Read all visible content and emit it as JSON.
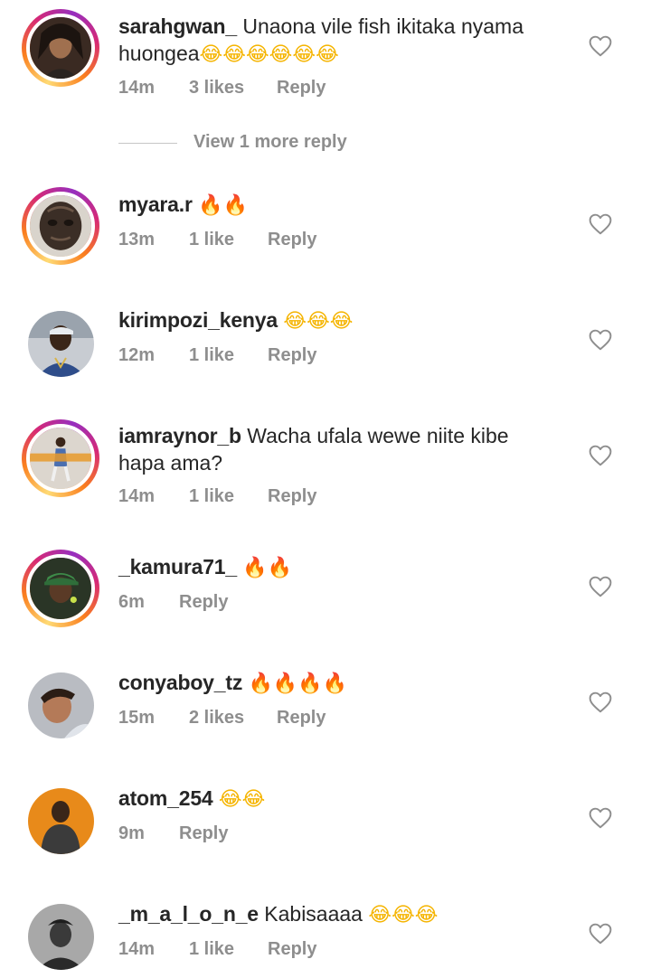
{
  "comments": [
    {
      "username": "sarahgwan_",
      "text": "Unaona vile fish ikitaka nyama huongea",
      "text_line2": "",
      "emoji": "😂😂😂😂😂😂",
      "time": "14m",
      "likes": "3 likes",
      "reply": "Reply",
      "story_ring": true,
      "avatar_color": "#3a2a22"
    },
    {
      "username": "myara.r",
      "text": "",
      "emoji": "🔥🔥",
      "time": "13m",
      "likes": "1 like",
      "reply": "Reply",
      "story_ring": true,
      "avatar_color": "#5b4a3c"
    },
    {
      "username": "kirimpozi_kenya",
      "text": "",
      "emoji": "😂😂😂",
      "time": "12m",
      "likes": "1 like",
      "reply": "Reply",
      "story_ring": false,
      "avatar_color": "#2f4d8a"
    },
    {
      "username": "iamraynor_b",
      "text": "Wacha ufala wewe niite kibe",
      "text_line2": "hapa ama?",
      "emoji": "",
      "time": "14m",
      "likes": "1 like",
      "reply": "Reply",
      "story_ring": true,
      "avatar_color": "#c9c2b8"
    },
    {
      "username": "_kamura71_",
      "text": "",
      "emoji": "🔥🔥",
      "time": "6m",
      "likes": "",
      "reply": "Reply",
      "story_ring": true,
      "avatar_color": "#3c5a3a"
    },
    {
      "username": "conyaboy_tz",
      "text": "",
      "emoji": "🔥🔥🔥🔥",
      "time": "15m",
      "likes": "2 likes",
      "reply": "Reply",
      "story_ring": false,
      "avatar_color": "#8a8f99"
    },
    {
      "username": "atom_254",
      "text": "",
      "emoji": "😂😂",
      "time": "9m",
      "likes": "",
      "reply": "Reply",
      "story_ring": false,
      "avatar_color": "#e88a1a"
    },
    {
      "username": "_m_a_l_o_n_e",
      "text": "Kabisaaaa",
      "emoji": "😂😂😂",
      "time": "14m",
      "likes": "1 like",
      "reply": "Reply",
      "story_ring": false,
      "avatar_color": "#4a4a4a"
    }
  ],
  "view_more_replies": "View 1 more reply",
  "icons": {
    "like": "heart-icon"
  },
  "colors": {
    "meta_text": "#8e8e8e",
    "username": "#262626",
    "ring_start": "#feda75",
    "ring_end": "#d62976"
  }
}
